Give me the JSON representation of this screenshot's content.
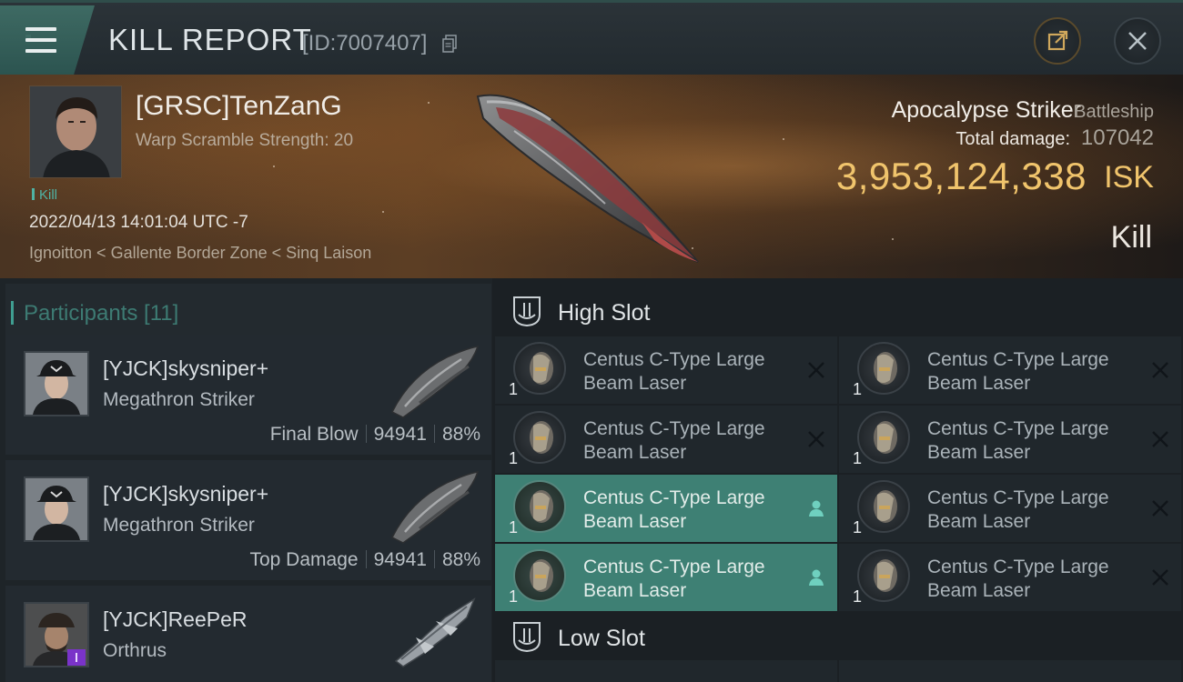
{
  "header": {
    "title": "KILL REPORT",
    "id_text": "[ID:7007407]"
  },
  "victim": {
    "name": "[GRSC]TenZanG",
    "warp_text": "Warp Scramble Strength: 20",
    "kill_tag": "Kill",
    "datetime": "2022/04/13 14:01:04 UTC -7",
    "location": "Ignoitton < Gallente Border Zone < Sinq Laison",
    "ship_name": "Apocalypse Striker",
    "ship_class": "Battleship",
    "total_damage_label": "Total damage:",
    "total_damage": "107042",
    "isk_value": "3,953,124,338",
    "isk_unit": "ISK",
    "result": "Kill"
  },
  "participants": {
    "title": "Participants [11]",
    "rows": [
      {
        "name": "[YJCK]skysniper+",
        "ship": "Megathron Striker",
        "role": "Final Blow",
        "damage": "94941",
        "percent": "88%"
      },
      {
        "name": "[YJCK]skysniper+",
        "ship": "Megathron Striker",
        "role": "Top Damage",
        "damage": "94941",
        "percent": "88%"
      },
      {
        "name": "[YJCK]ReePeR",
        "ship": "Orthrus"
      }
    ]
  },
  "slots": {
    "high_title": "High Slot",
    "low_title": "Low Slot",
    "modules": [
      {
        "name_line1": "Centus C-Type Large",
        "name_line2": "Beam Laser",
        "qty": "1"
      },
      {
        "name_line1": "Centus C-Type Large",
        "name_line2": "Beam Laser",
        "qty": "1"
      },
      {
        "name_line1": "Centus C-Type Large",
        "name_line2": "Beam Laser",
        "qty": "1"
      },
      {
        "name_line1": "Centus C-Type Large",
        "name_line2": "Beam Laser",
        "qty": "1"
      },
      {
        "name_line1": "Centus C-Type Large",
        "name_line2": "Beam Laser",
        "qty": "1"
      },
      {
        "name_line1": "Centus C-Type Large",
        "name_line2": "Beam Laser",
        "qty": "1"
      },
      {
        "name_line1": "Centus C-Type Large",
        "name_line2": "Beam Laser",
        "qty": "1"
      },
      {
        "name_line1": "Centus C-Type Large",
        "name_line2": "Beam Laser",
        "qty": "1"
      }
    ]
  },
  "colors": {
    "accent_teal": "#3e8074",
    "isk_gold": "#f0c46c",
    "header_bg": "#2b3338"
  }
}
